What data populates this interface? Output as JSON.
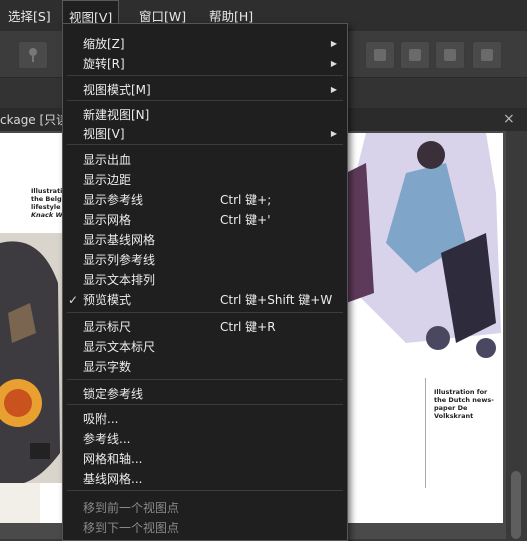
{
  "menubar": {
    "items": [
      "选择[S]",
      "视图[V]",
      "窗口[W]",
      "帮助[H]"
    ]
  },
  "document_tab": {
    "title": "ckage [只读]",
    "close": "×"
  },
  "page_content": {
    "caption_left": [
      "Illustration for",
      "the Belgian",
      "lifestyle magazine",
      "Knack Weekend"
    ],
    "caption_right": [
      "Illustration for",
      "the Dutch news-",
      "paper De Volkskrant"
    ]
  },
  "view_menu": {
    "items": [
      {
        "label": "缩放[Z]",
        "submenu": true
      },
      {
        "label": "旋转[R]",
        "submenu": true
      },
      {
        "label": "视图模式[M]",
        "submenu": true
      },
      {
        "label": "新建视图[N]"
      },
      {
        "label": "视图[V]",
        "submenu": true
      },
      {
        "label": "显示出血"
      },
      {
        "label": "显示边距"
      },
      {
        "label": "显示参考线",
        "shortcut": "Ctrl 键+;"
      },
      {
        "label": "显示网格",
        "shortcut": "Ctrl 键+'"
      },
      {
        "label": "显示基线网格"
      },
      {
        "label": "显示列参考线"
      },
      {
        "label": "显示文本排列"
      },
      {
        "label": "预览模式",
        "shortcut": "Ctrl 键+Shift 键+W",
        "checked": true
      },
      {
        "label": "显示标尺",
        "shortcut": "Ctrl 键+R"
      },
      {
        "label": "显示文本标尺"
      },
      {
        "label": "显示字数"
      },
      {
        "label": "锁定参考线"
      },
      {
        "label": "吸附..."
      },
      {
        "label": "参考线..."
      },
      {
        "label": "网格和轴..."
      },
      {
        "label": "基线网格..."
      },
      {
        "label": "移到前一个视图点",
        "disabled": true
      },
      {
        "label": "移到下一个视图点",
        "disabled": true
      }
    ],
    "arrow_glyph": "▶",
    "check_glyph": "✓"
  }
}
